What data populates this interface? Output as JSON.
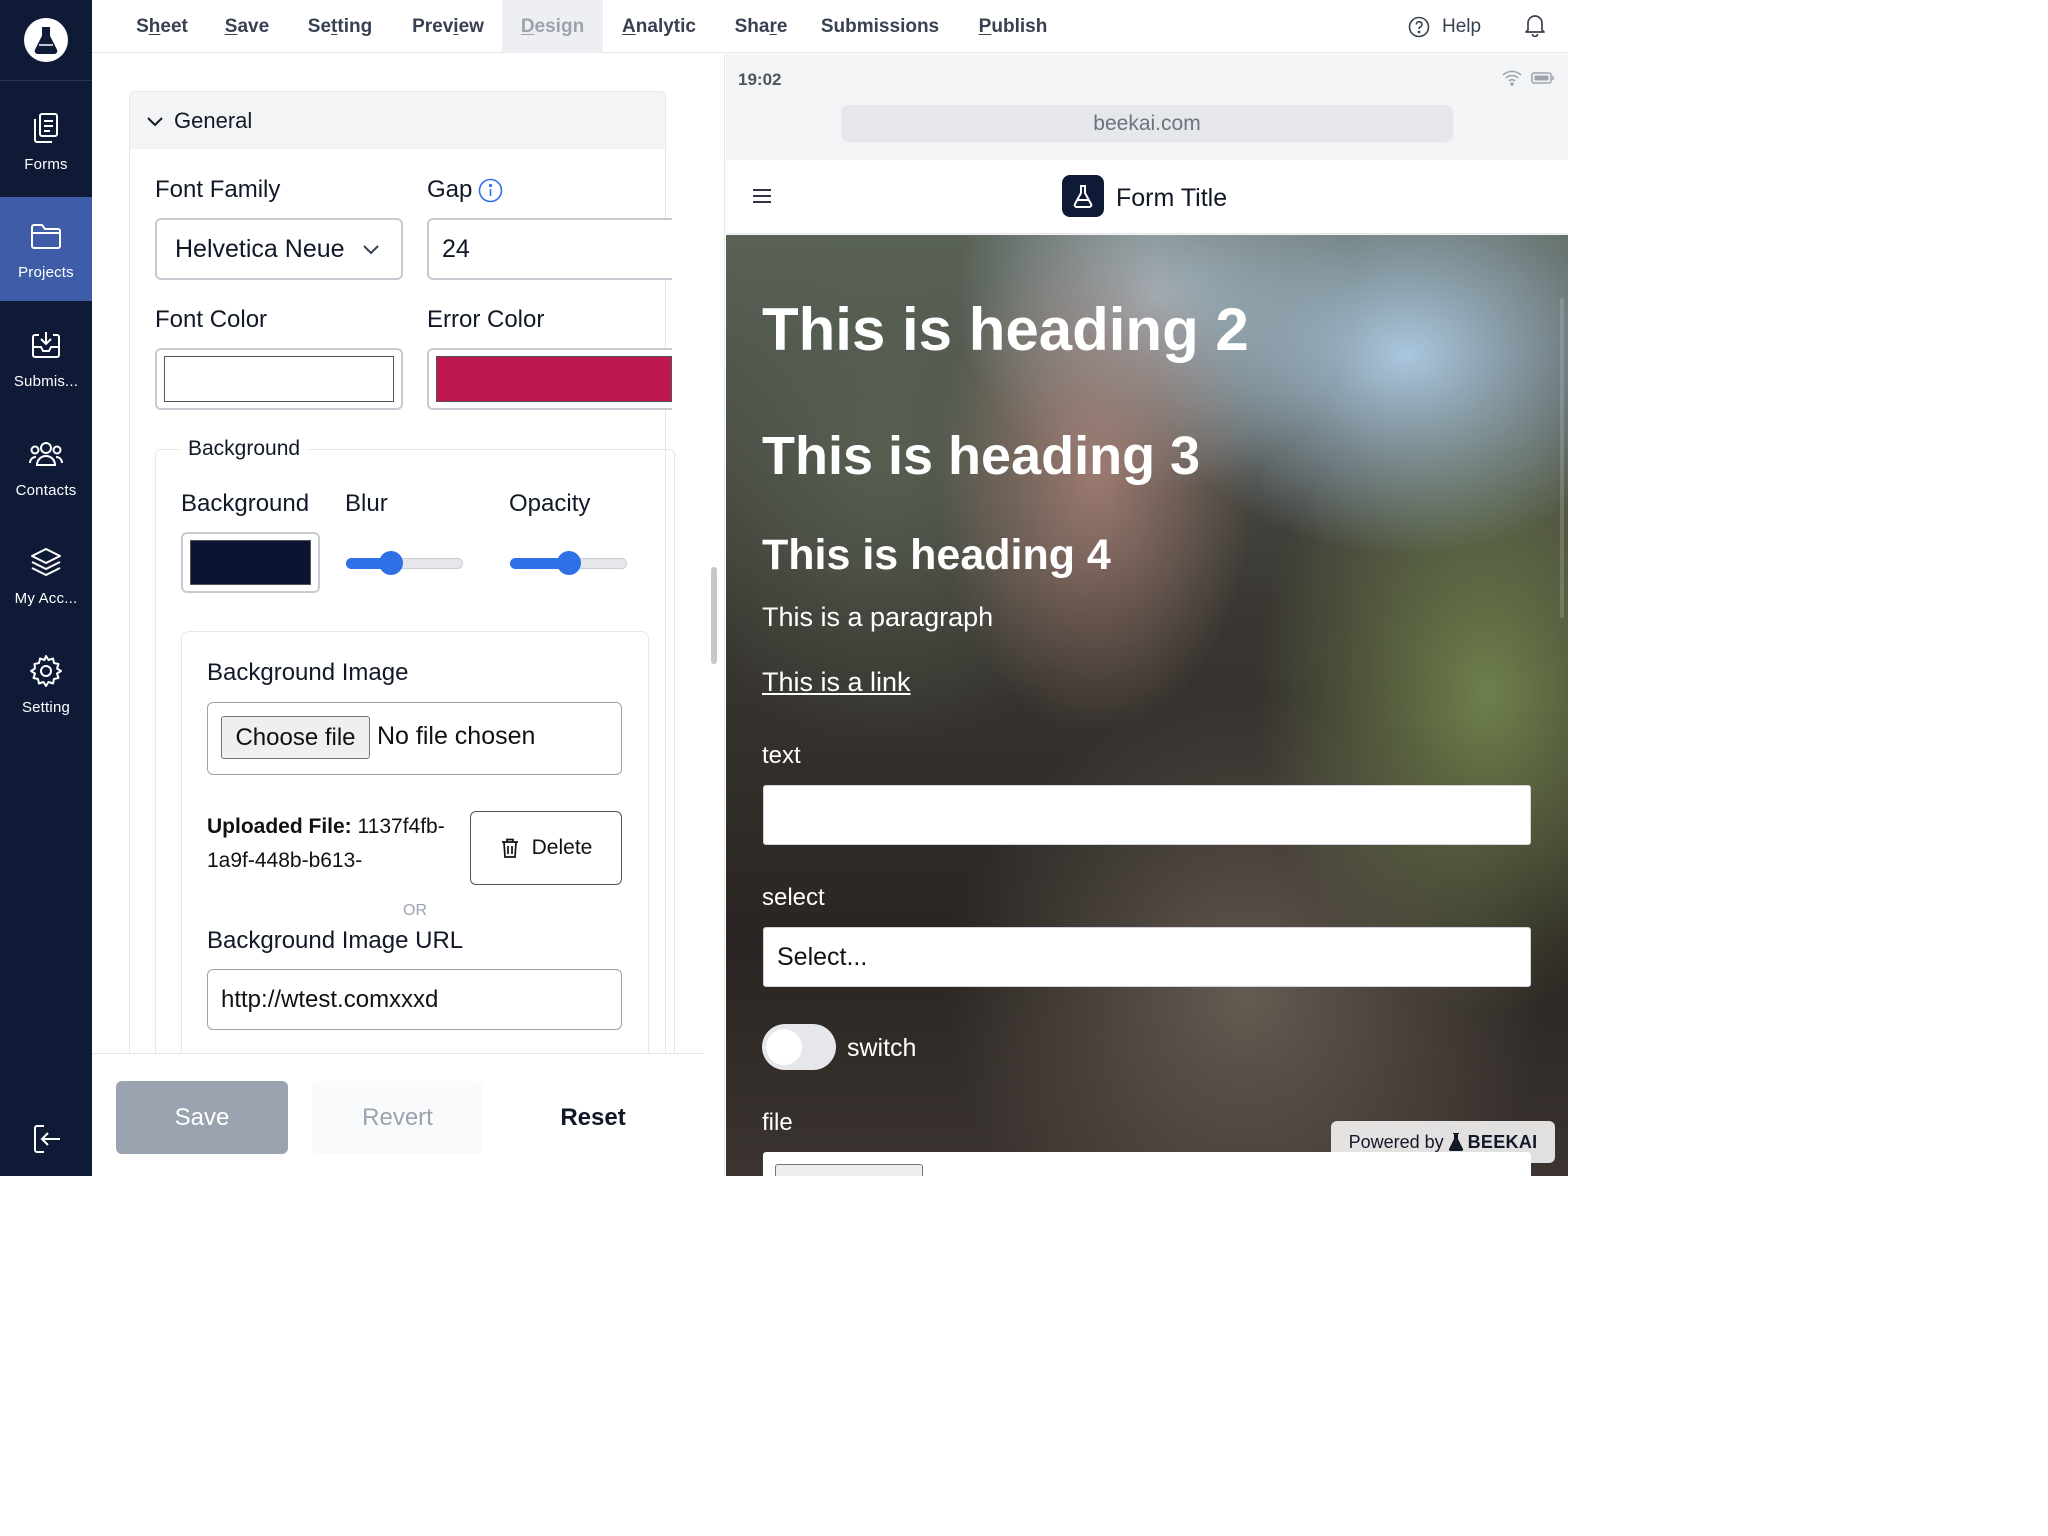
{
  "sidebar": {
    "items": [
      {
        "label": "Forms",
        "icon": "forms-icon"
      },
      {
        "label": "Projects",
        "icon": "folder-icon",
        "active": true
      },
      {
        "label": "Submis...",
        "icon": "inbox-icon"
      },
      {
        "label": "Contacts",
        "icon": "contacts-icon"
      },
      {
        "label": "My Acc...",
        "icon": "layers-icon"
      },
      {
        "label": "Setting",
        "icon": "gear-icon"
      }
    ]
  },
  "topbar": {
    "menu": [
      {
        "label": "Sheet",
        "underline_index": 1
      },
      {
        "label": "Save",
        "underline_index": 0
      },
      {
        "label": "Setting",
        "underline_index": 2
      },
      {
        "label": "Preview",
        "underline_index": 4
      },
      {
        "label": "Design",
        "underline_index": 0,
        "active": true
      },
      {
        "label": "Analytic",
        "underline_index": 0
      },
      {
        "label": "Share",
        "underline_index": 3
      },
      {
        "label": "Submissions",
        "underline_index": -1
      },
      {
        "label": "Publish",
        "underline_index": 0
      }
    ],
    "help": "Help"
  },
  "editor": {
    "section_title": "General",
    "font_family_label": "Font Family",
    "font_family_value": "Helvetica Neue",
    "gap_label": "Gap",
    "gap_value": "24",
    "font_color_label": "Font Color",
    "font_color_value": "#ffffff",
    "error_color_label": "Error Color",
    "error_color_value": "#be1650",
    "background_legend": "Background",
    "background_label": "Background",
    "background_color": "#0b1430",
    "blur_label": "Blur",
    "blur_value_fraction": 0.36,
    "opacity_label": "Opacity",
    "opacity_value_fraction": 0.5,
    "bg_image_label": "Background Image",
    "choose_file": "Choose file",
    "no_file": "No file chosen",
    "uploaded_label": "Uploaded File:",
    "uploaded_value": "1137f4fb-1a9f-448b-b613-",
    "delete_label": "Delete",
    "or_text": "OR",
    "bg_url_label": "Background Image URL",
    "bg_url_value": "http://wtest.comxxxd"
  },
  "actions": {
    "save": "Save",
    "revert": "Revert",
    "reset": "Reset"
  },
  "preview": {
    "time": "19:02",
    "url": "beekai.com",
    "form_title": "Form Title",
    "heading2": "This is heading 2",
    "heading3": "This is heading 3",
    "heading4": "This is heading 4",
    "paragraph": "This is a paragraph",
    "link": "This is a link",
    "text_label": "text",
    "select_label": "select",
    "select_placeholder": "Select...",
    "switch_label": "switch",
    "file_label": "file",
    "powered_by": "Powered by",
    "brand": "BEEKAI"
  },
  "colors": {
    "sidebar_bg": "#0e1a36",
    "sidebar_active": "#3f5ca8",
    "accent": "#2f6fe8"
  }
}
